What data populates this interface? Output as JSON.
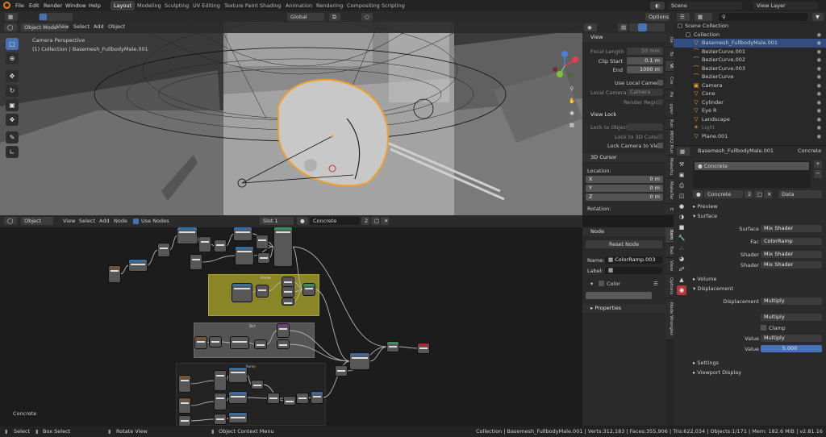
{
  "topbar": {
    "menus": [
      "File",
      "Edit",
      "Render",
      "Window",
      "Help"
    ],
    "workspaces": [
      "Layout",
      "Modeling",
      "Sculpting",
      "UV Editing",
      "Texture Paint",
      "Shading",
      "Animation",
      "Rendering",
      "Compositing",
      "Scripting"
    ],
    "active_workspace": "Layout",
    "scene": "Scene",
    "view_layer": "View Layer"
  },
  "tool_header": {
    "orientation": "Global",
    "options": "Options"
  },
  "viewport": {
    "mode": "Object Mode",
    "menus": [
      "View",
      "Select",
      "Add",
      "Object"
    ],
    "overlay_title": "Camera Perspective",
    "overlay_sub": "(1) Collection | Basemesh_FullbodyMale.001",
    "tools_icons": [
      "select-box-icon",
      "cursor-icon",
      "move-icon",
      "rotate-icon",
      "scale-icon",
      "transform-icon",
      "annotate-icon",
      "measure-icon"
    ],
    "gizmo_axes": [
      "X",
      "Y",
      "Z"
    ]
  },
  "viewport_npanel": {
    "view": {
      "title": "View",
      "focal_length_label": "Focal Length",
      "focal_length": "50 mm",
      "clip_start_label": "Clip Start",
      "clip_start": "0.1 m",
      "end_label": "End",
      "end": "1000 m",
      "use_local_camera": "Use Local Camera",
      "local_camera_label": "Local Camera",
      "local_camera": "Camera",
      "render_region": "Render Region"
    },
    "view_lock": {
      "title": "View Lock",
      "lock_to_object": "Lock to Object",
      "lock_to_3d_cursor": "Lock to 3D Cursor",
      "lock_camera_to_view": "Lock Camera to View"
    },
    "cursor": {
      "title": "3D Cursor",
      "location_label": "Location:",
      "x": "0 m",
      "y": "0 m",
      "z": "0 m",
      "rotation_label": "Rotation:"
    },
    "tabs": [
      "Ite",
      "To",
      "Vi",
      "Cre",
      "Pa",
      "pper",
      "Run",
      "MHX2 Run",
      "Makehu",
      "MakeTar",
      "E"
    ]
  },
  "node_editor": {
    "type": "Object",
    "menus": [
      "View",
      "Select",
      "Add",
      "Node"
    ],
    "use_nodes": "Use Nodes",
    "slot": "Slot 1",
    "material": "Concrete",
    "users": "2",
    "corner_label": "Concrete",
    "frames": [
      "Frame",
      "Dirt",
      "Bump"
    ]
  },
  "node_npanel": {
    "node_title": "Node",
    "reset_node": "Reset Node",
    "name_label": "Name:",
    "name": "ColorRamp.003",
    "label_label": "Label:",
    "color_label": "Color",
    "properties": "Properties",
    "tabs": [
      "Item",
      "Tool",
      "View",
      "Options",
      "Node Wrangler"
    ]
  },
  "outliner": {
    "root": "Scene Collection",
    "items": [
      {
        "name": "Collection",
        "icon": "collection-icon",
        "indent": 1
      },
      {
        "name": "Basemesh_FullbodyMale.001",
        "icon": "mesh-icon",
        "indent": 2,
        "selected": true
      },
      {
        "name": "BezierCurve.001",
        "icon": "curve-icon",
        "indent": 2
      },
      {
        "name": "BezierCurve.002",
        "icon": "curve-icon",
        "indent": 2
      },
      {
        "name": "BezierCurve.003",
        "icon": "curve-icon",
        "indent": 2
      },
      {
        "name": "BezierCurve",
        "icon": "curve-icon",
        "indent": 2
      },
      {
        "name": "Camera",
        "icon": "camera-icon",
        "indent": 2
      },
      {
        "name": "Cone",
        "icon": "mesh-icon",
        "indent": 2
      },
      {
        "name": "Cylinder",
        "icon": "mesh-icon",
        "indent": 2
      },
      {
        "name": "Eye R",
        "icon": "mesh-icon",
        "indent": 2
      },
      {
        "name": "Landscape",
        "icon": "mesh-icon",
        "indent": 2
      },
      {
        "name": "Light",
        "icon": "light-icon",
        "indent": 2
      },
      {
        "name": "Plane.001",
        "icon": "mesh-icon",
        "indent": 2
      }
    ]
  },
  "properties": {
    "object": "Basemesh_FullbodyMale.001",
    "material_slot": "Concrete",
    "material_breadcrumb": "Concrete",
    "material": "Concrete",
    "users": "2",
    "data": "Data",
    "preview": "Preview",
    "surface_section": "Surface",
    "surface_label": "Surface",
    "surface": "Mix Shader",
    "fac_label": "Fac",
    "fac": "ColorRamp",
    "shader1_label": "Shader",
    "shader1": "Mix Shader",
    "shader2_label": "Shader",
    "shader2": "Mix Shader",
    "volume": "Volume",
    "displacement_section": "Displacement",
    "displacement_label": "Displacement",
    "displacement": "Multiply",
    "disp_op": "Multiply",
    "clamp": "Clamp",
    "value1_label": "Value",
    "value1": "Multiply",
    "value2_label": "Value",
    "value2": "5.000",
    "settings": "Settings",
    "viewport_display": "Viewport Display"
  },
  "status": {
    "select": "Select",
    "box_select": "Box Select",
    "rotate_view": "Rotate View",
    "context_menu": "Object Context Menu",
    "stats": "Collection | Basemesh_FullbodyMale.001 | Verts:312,183 | Faces:355,906 | Tris:622,034 | Objects:1/171 | Mem: 182.6 MiB | v2.81.16"
  },
  "colors": {
    "accent": "#4772b3",
    "selection_outline": "#f0a030",
    "frame_yellow": "#8a8526",
    "frame_grey": "#545454"
  }
}
